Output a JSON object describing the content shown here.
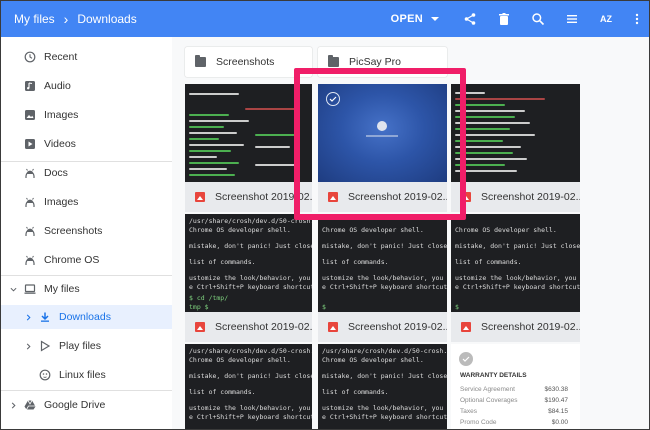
{
  "breadcrumb": {
    "root": "My files",
    "current": "Downloads"
  },
  "toolbar": {
    "open_label": "OPEN",
    "sort_label": "AZ"
  },
  "sidebar": {
    "items": [
      {
        "label": "Recent"
      },
      {
        "label": "Audio"
      },
      {
        "label": "Images"
      },
      {
        "label": "Videos"
      },
      {
        "label": "Docs"
      },
      {
        "label": "Images"
      },
      {
        "label": "Screenshots"
      },
      {
        "label": "Chrome OS"
      },
      {
        "label": "My files"
      },
      {
        "label": "Downloads"
      },
      {
        "label": "Play files"
      },
      {
        "label": "Linux files"
      },
      {
        "label": "Google Drive"
      }
    ]
  },
  "folders": [
    {
      "name": "Screenshots"
    },
    {
      "name": "PicSay Pro"
    }
  ],
  "files": [
    {
      "name": "Screenshot 2019-02..."
    },
    {
      "name": "Screenshot 2019-02..."
    },
    {
      "name": "Screenshot 2019-02..."
    },
    {
      "name": "Screenshot 2019-02..."
    },
    {
      "name": "Screenshot 2019-02..."
    },
    {
      "name": "Screenshot 2019-02..."
    }
  ],
  "terminal_text": {
    "path": "/usr/share/crosh/dev.d/50-crosh.sh",
    "shell": "Chrome OS developer shell.",
    "mistake": "mistake, don't panic!  Just close this tab a",
    "list": "list of commands.",
    "customize": "ustomize the look/behavior, you can use the opt",
    "shortcut": "e Ctrl+Shift+P keyboard shortcut.",
    "cd": "$ cd /tmp/",
    "prompt": "tmp $ ",
    "prompt2": "$"
  },
  "warranty": {
    "title": "WARRANTY DETAILS",
    "rows": [
      {
        "k": "Service Agreement",
        "v": "$630.38"
      },
      {
        "k": "Optional Coverages",
        "v": "$190.47"
      },
      {
        "k": "Taxes",
        "v": "$84.15"
      },
      {
        "k": "Promo Code",
        "v": "$0.00"
      }
    ]
  },
  "colors": {
    "topbar": "#4285f4",
    "highlight": "#f01e68",
    "active": "#1a73e8"
  }
}
